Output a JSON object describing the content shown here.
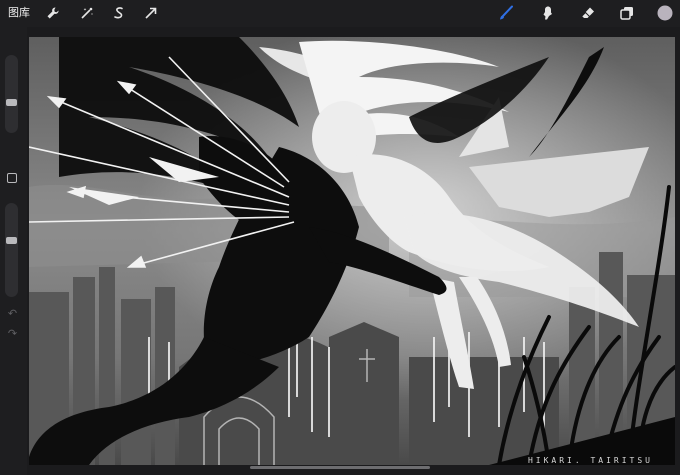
{
  "toolbar": {
    "gallery_label": "图库",
    "left_tools": [
      {
        "name": "actions-icon"
      },
      {
        "name": "adjustments-icon"
      },
      {
        "name": "selection-icon"
      },
      {
        "name": "transform-icon"
      }
    ],
    "right_tools": [
      {
        "name": "brush-icon",
        "active": true,
        "color": "#2f6fe4"
      },
      {
        "name": "smudge-icon"
      },
      {
        "name": "eraser-icon"
      },
      {
        "name": "layers-icon"
      },
      {
        "name": "color-swatch",
        "color": "#b9b3bd"
      }
    ]
  },
  "sidebar": {
    "size_slider_level": 0.5,
    "opacity_slider_level": 0.4,
    "modify_button": "square-icon",
    "undo": "undo-icon",
    "redo": "redo-icon"
  },
  "artwork": {
    "signature": "HIKARI. TAIRITSU",
    "palette": {
      "sky": "#6b6b6b",
      "light": "#f2f2f2",
      "dark": "#0d0d0d"
    }
  }
}
